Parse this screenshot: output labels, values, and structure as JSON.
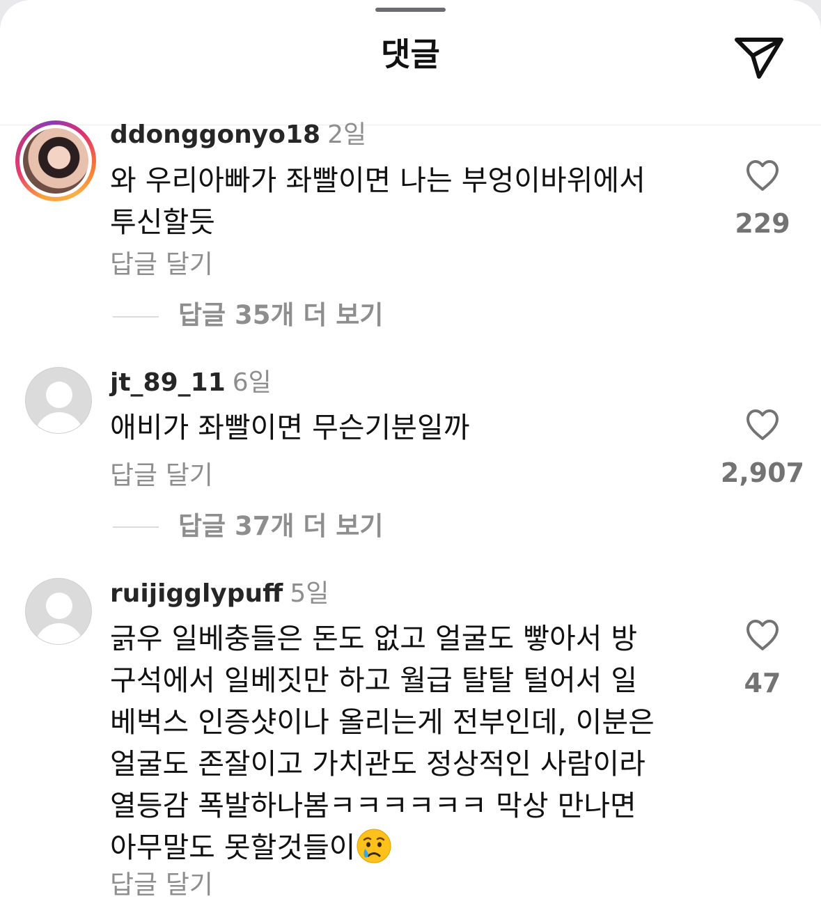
{
  "header": {
    "title": "댓글",
    "share_icon": "send-icon"
  },
  "comments": [
    {
      "username": "ddonggonyo18",
      "time": "2일",
      "avatar": "profile-photo",
      "text": "와 우리아빠가 좌빨이면 나는 부엉이바위에서\n투신할듯",
      "reply_label": "답글 달기",
      "likes": "229",
      "view_replies": "답글 35개 더 보기"
    },
    {
      "username": "jt_89_11",
      "time": "6일",
      "avatar": "default-avatar",
      "text": "애비가 좌빨이면 무슨기분일까",
      "reply_label": "답글 달기",
      "likes": "2,907",
      "view_replies": "답글 37개 더 보기"
    },
    {
      "username": "ruijigglypuff",
      "time": "5일",
      "avatar": "default-avatar",
      "text": "긁우 일베충들은 돈도 없고 얼굴도 빻아서 방\n구석에서 일베짓만 하고 월급 탈탈 털어서 일\n베벅스 인증샷이나 올리는게 전부인데, 이분은\n얼굴도 존잘이고 가치관도 정상적인 사람이라\n열등감 폭발하나봄ㅋㅋㅋㅋㅋㅋ 막상 만나면\n아무말도 못할것들이",
      "text_emoji": "crying-face-emoji",
      "reply_label": "답글 달기",
      "likes": "47"
    }
  ]
}
